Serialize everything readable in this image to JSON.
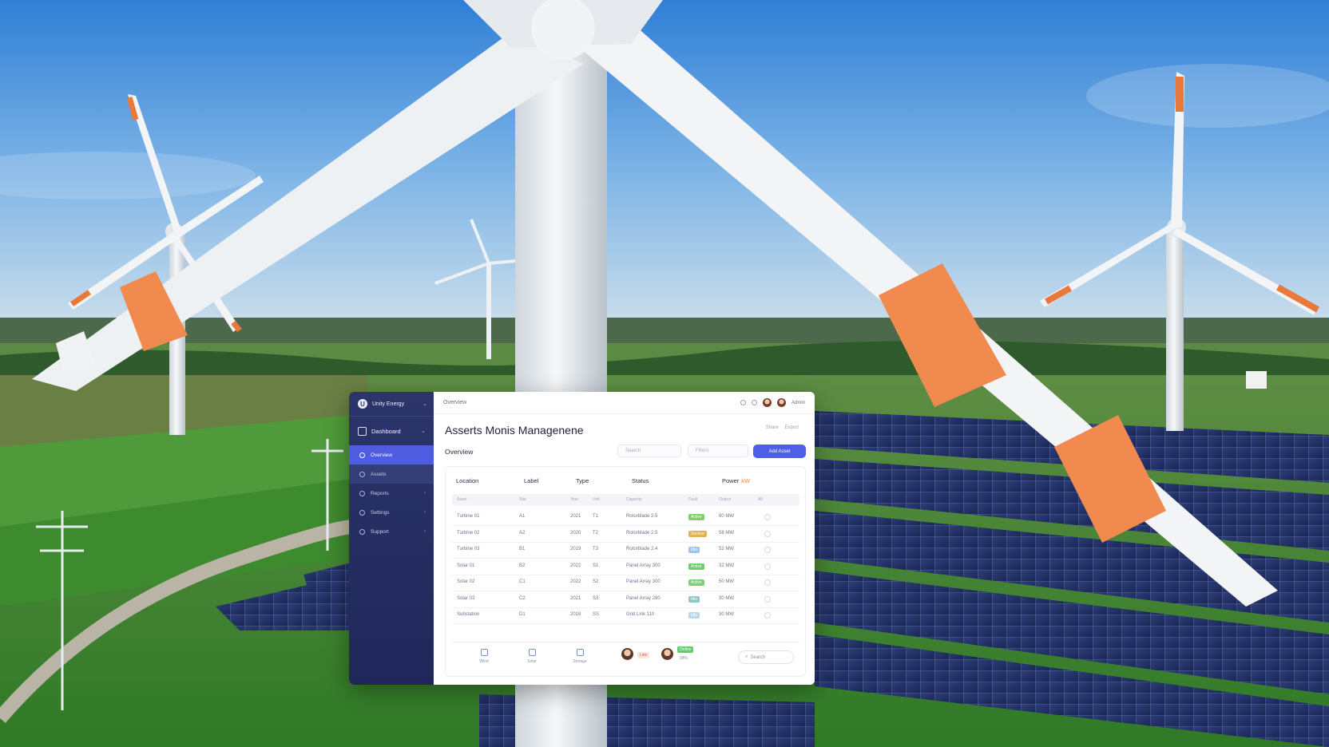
{
  "sidebar": {
    "brand": "Unity Energy",
    "dashboard": "Dashboard",
    "items": [
      {
        "label": "Overview",
        "icon": "grid-icon",
        "active": true
      },
      {
        "label": "Assets",
        "icon": "asset-icon"
      },
      {
        "label": "Reports",
        "icon": "chart-icon",
        "chevron": "›"
      },
      {
        "label": "Settings",
        "icon": "settings-icon",
        "chevron": "›"
      },
      {
        "label": "Support",
        "icon": "help-icon",
        "chevron": "›"
      }
    ],
    "chevron": "⌄"
  },
  "topbar": {
    "breadcrumb": "Overview",
    "username": "Admin"
  },
  "page": {
    "title": "Asserts Monis Managenene",
    "title_action_1": "Share",
    "title_action_2": "Export",
    "subtitle": "Overview",
    "filter_1": "Search",
    "filter_2": "Filters",
    "primary_button": "Add Asset"
  },
  "table": {
    "column_heads": [
      "Location",
      "Label",
      "Type",
      "Status",
      "Power"
    ],
    "power_accent": "kW",
    "header_cells": [
      "Asset",
      "Site",
      "Year",
      "Unit",
      "Capacity",
      "Fault",
      "Output",
      "Alt"
    ],
    "rows": [
      {
        "name": "Turbine 01",
        "site": "A1",
        "year": "2021",
        "unit": "T1",
        "cap": "Rotorblade 2.5",
        "status": "Active",
        "status_color": "#7dd06a",
        "out": "60 MW"
      },
      {
        "name": "Turbine 02",
        "site": "A2",
        "year": "2020",
        "unit": "T2",
        "cap": "Rotorblade 2.5",
        "status": "Service",
        "status_color": "#e0b45a",
        "out": "58 MW"
      },
      {
        "name": "Turbine 03",
        "site": "B1",
        "year": "2019",
        "unit": "T3",
        "cap": "Rotorblade 2.4",
        "status": "Idle",
        "status_color": "#9ec6ea",
        "out": "52 MW"
      },
      {
        "name": "Solar 01",
        "site": "B2",
        "year": "2022",
        "unit": "S1",
        "cap": "Panel Array 300",
        "status": "Active",
        "status_color": "#6fcf6a",
        "out": "32 MW"
      },
      {
        "name": "Solar 02",
        "site": "C1",
        "year": "2022",
        "unit": "S2",
        "cap": "Panel Array 300",
        "status": "Active",
        "status_color": "#7bd07a",
        "out": "50 MW"
      },
      {
        "name": "Solar 03",
        "site": "C2",
        "year": "2021",
        "unit": "S3",
        "cap": "Panel Array 280",
        "status": "Idle",
        "status_color": "#8fc8c0",
        "out": "30 MW"
      },
      {
        "name": "Substation",
        "site": "D1",
        "year": "2018",
        "unit": "SS",
        "cap": "Grid Link 110",
        "status": "Idle",
        "status_color": "#b9d8ea",
        "out": "30 MW"
      }
    ]
  },
  "footer": {
    "items": [
      "Wind",
      "Solar",
      "Storage"
    ],
    "tag_1": "Live",
    "tag_2": "Online",
    "tag_2_sub": "98%",
    "search": "Search"
  },
  "colors": {
    "sidebar_bg": "#24306a",
    "accent": "#4c5fe6",
    "sky": "#5b9ae0",
    "grass": "#3f8a35"
  }
}
